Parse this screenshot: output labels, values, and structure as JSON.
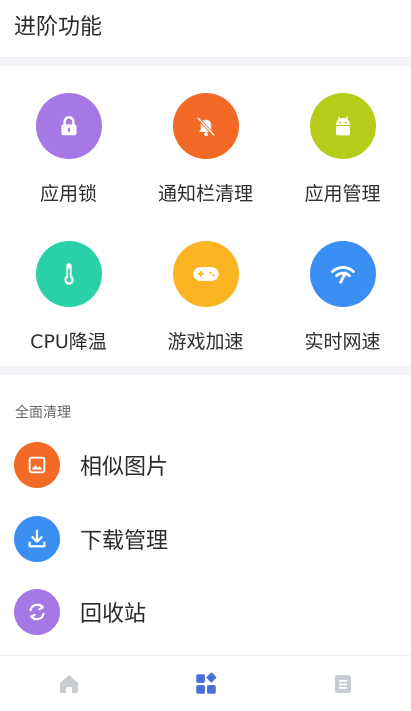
{
  "header": {
    "title": "进阶功能"
  },
  "features": [
    {
      "label": "应用锁",
      "icon": "lock-icon",
      "color": "#a678e6"
    },
    {
      "label": "通知栏清理",
      "icon": "bell-off-icon",
      "color": "#f26a26"
    },
    {
      "label": "应用管理",
      "icon": "android-icon",
      "color": "#b5cc18"
    },
    {
      "label": "CPU降温",
      "icon": "thermometer-icon",
      "color": "#2bd1a6"
    },
    {
      "label": "游戏加速",
      "icon": "gamepad-icon",
      "color": "#fbb523"
    },
    {
      "label": "实时网速",
      "icon": "wifi-icon",
      "color": "#3b8ff3"
    }
  ],
  "cleanup": {
    "title": "全面清理",
    "items": [
      {
        "label": "相似图片",
        "icon": "photo-icon",
        "color": "#f26a26"
      },
      {
        "label": "下载管理",
        "icon": "download-icon",
        "color": "#3b8ff3"
      },
      {
        "label": "回收站",
        "icon": "recycle-icon",
        "color": "#a678e6"
      }
    ]
  },
  "bottom_nav": {
    "items": [
      {
        "icon": "home-icon",
        "active": false
      },
      {
        "icon": "apps-icon",
        "active": true
      },
      {
        "icon": "document-icon",
        "active": false
      }
    ],
    "active_color": "#4b6fd6",
    "inactive_color": "#c9ccd3"
  }
}
